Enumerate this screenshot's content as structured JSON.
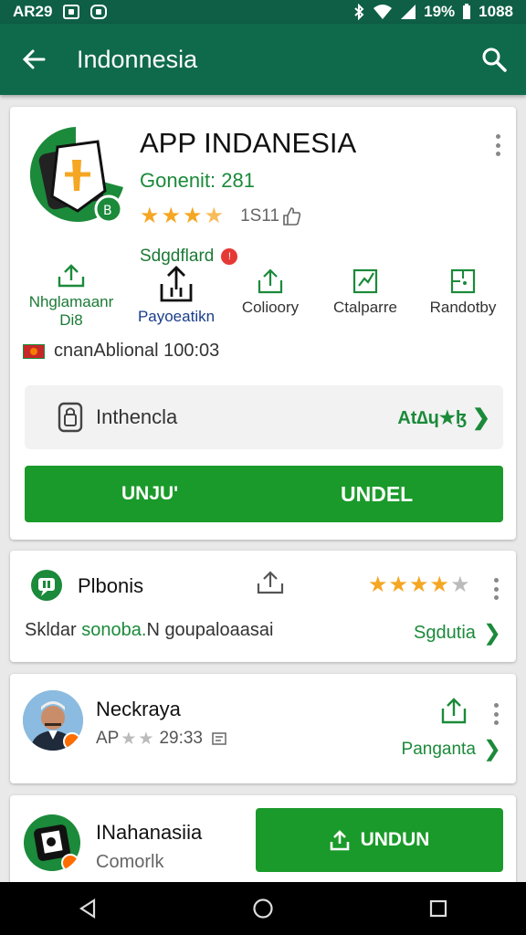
{
  "status_bar": {
    "time": "AR29",
    "battery": "19%",
    "clock": "1088"
  },
  "app_bar": {
    "title": "Indonnesia"
  },
  "main_card": {
    "title": "APP INDANESIA",
    "developer": "Gonenit: 281",
    "rating_stars": 3.5,
    "rating_count": "1S11",
    "suggestion": "Sdgdflard",
    "actions": [
      {
        "label": "Nhglamaanr\nDi8",
        "icon": "share-icon"
      },
      {
        "label": "Payoeatikn",
        "icon": "share-icon"
      },
      {
        "label": "Colioory",
        "icon": "share-icon"
      },
      {
        "label": "Ctalparre",
        "icon": "chart-icon"
      },
      {
        "label": "Randotby",
        "icon": "square-icon"
      }
    ],
    "info": "cnanAblional 100:03",
    "rate_label": "Inthencla",
    "rate_mini": "At∆ɥ★ɮ",
    "install_left": "UNJU'",
    "install_right": "UNDEL"
  },
  "card2": {
    "name": "Plbonis",
    "rating_stars": 4,
    "desc_black": "Skldar",
    "desc_green": "sonoba.",
    "desc_black2": "N goupaloaasai",
    "more": "Sgdutia"
  },
  "card3": {
    "name": "Neckraya",
    "meta_prefix": "AP",
    "meta_time": "29:33",
    "more": "Panganta"
  },
  "card4": {
    "name": "INahanasiia",
    "sub": "Comorlk",
    "button": "UNDUN"
  },
  "colors": {
    "primary": "#0f6a4b",
    "accent": "#1a9a2a",
    "star": "#f5a623"
  }
}
